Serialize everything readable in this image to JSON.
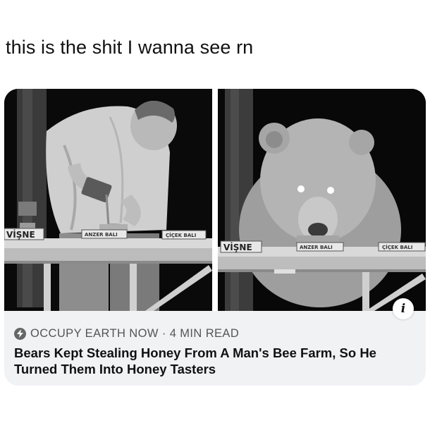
{
  "post": {
    "text": "this is the shit I wanna see rn"
  },
  "card": {
    "source": "OCCUPY EARTH NOW",
    "separator": "·",
    "read_time": "4 MIN READ",
    "headline": "Bears Kept Stealing Honey From A Man's Bee Farm, So He Turned Them Into Honey Tasters",
    "info_glyph": "i",
    "source_icon": "bolt-icon"
  },
  "photo_left": {
    "labels": [
      "VİŞNE",
      "ANZER BALI",
      "ÇİÇEK BALI"
    ]
  },
  "photo_right": {
    "labels": [
      "VİŞNE",
      "ANZER BALI",
      "ÇİÇEK BALI"
    ]
  }
}
